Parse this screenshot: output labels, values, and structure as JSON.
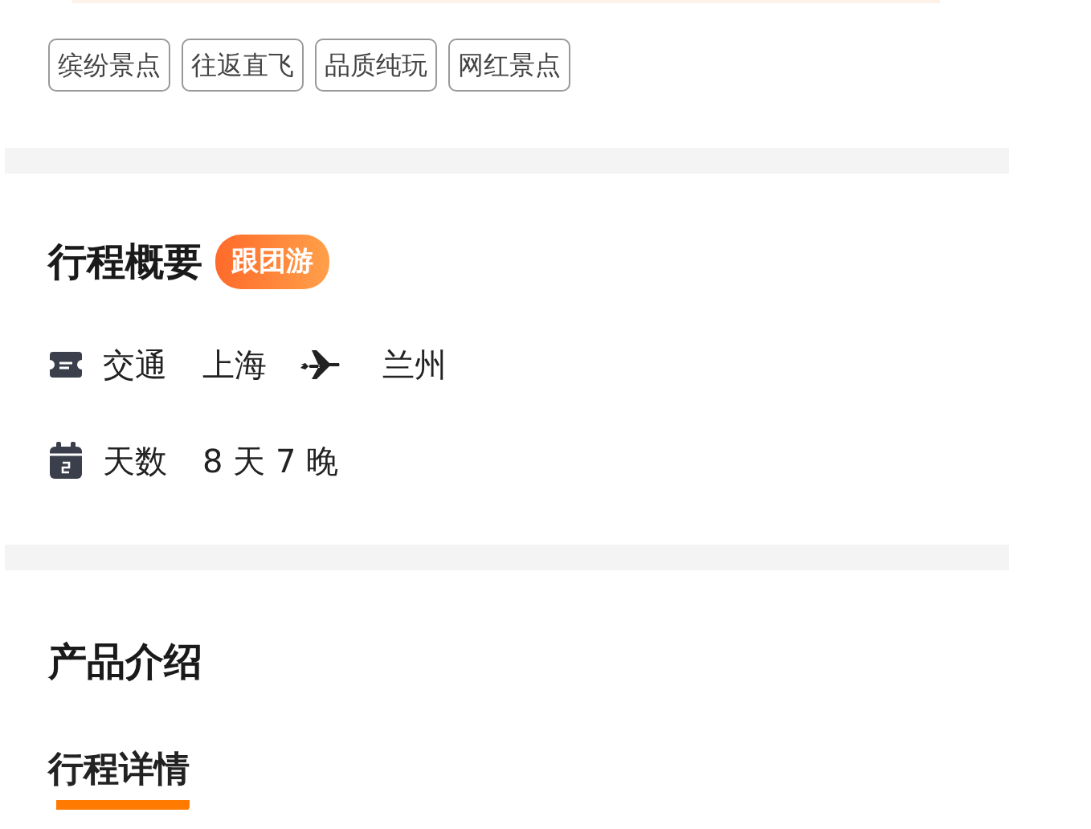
{
  "tags": [
    "缤纷景点",
    "往返直飞",
    "品质纯玩",
    "网红景点"
  ],
  "overview": {
    "title": "行程概要",
    "badge": "跟团游",
    "rows": [
      {
        "kind": "transport",
        "label": "交通",
        "from": "上海",
        "to": "兰州"
      },
      {
        "kind": "days",
        "label": "天数",
        "value": "8 天 7 晚"
      }
    ]
  },
  "intro": {
    "title": "产品介绍",
    "tabs": [
      {
        "label": "行程详情",
        "selected": true
      }
    ]
  }
}
